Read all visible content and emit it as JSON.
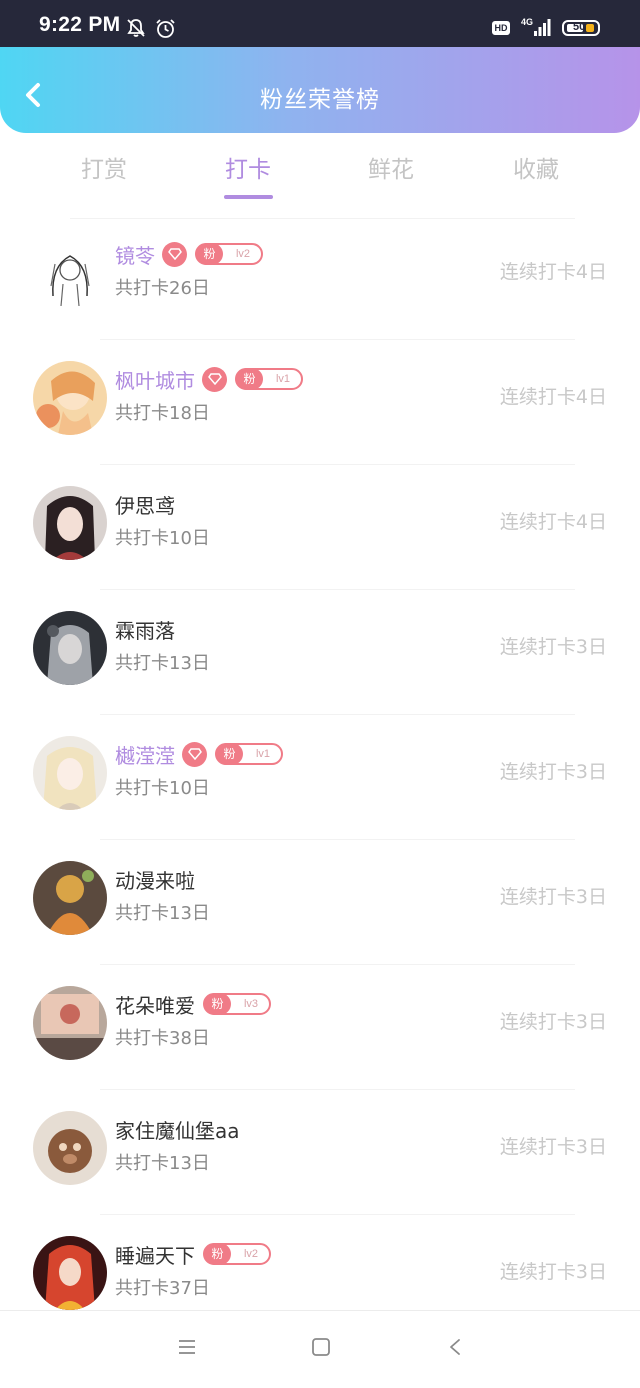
{
  "status_bar": {
    "time": "9:22 PM",
    "network": "4G",
    "hd_label": "HD",
    "battery": "50",
    "icons": [
      "bell-off-icon",
      "alarm-icon",
      "hd-icon",
      "signal-icon",
      "battery-icon"
    ]
  },
  "header": {
    "title": "粉丝荣誉榜",
    "back_icon": "chevron-left-icon"
  },
  "tabs": [
    {
      "label": "打赏",
      "active": false
    },
    {
      "label": "打卡",
      "active": true
    },
    {
      "label": "鲜花",
      "active": false
    },
    {
      "label": "收藏",
      "active": false
    }
  ],
  "colors": {
    "accent": "#b08ce0",
    "badge": "#f07b87",
    "header_gradient": [
      "#4fd6f3",
      "#b693e9"
    ],
    "status_bar": "#26283a"
  },
  "fans": [
    {
      "name": "镜苓",
      "vip": true,
      "fan_level": "lv2",
      "total": "共打卡26日",
      "streak": "连续打卡4日"
    },
    {
      "name": "枫叶城市",
      "vip": true,
      "fan_level": "lv1",
      "total": "共打卡18日",
      "streak": "连续打卡4日"
    },
    {
      "name": "伊思鸢",
      "vip": false,
      "fan_level": null,
      "total": "共打卡10日",
      "streak": "连续打卡4日"
    },
    {
      "name": "霖雨落",
      "vip": false,
      "fan_level": null,
      "total": "共打卡13日",
      "streak": "连续打卡3日"
    },
    {
      "name": "樾滢滢",
      "vip": true,
      "fan_level": "lv1",
      "total": "共打卡10日",
      "streak": "连续打卡3日"
    },
    {
      "name": "动漫来啦",
      "vip": false,
      "fan_level": null,
      "total": "共打卡13日",
      "streak": "连续打卡3日"
    },
    {
      "name": "花朵唯爱",
      "vip": false,
      "fan_level": "lv3",
      "total": "共打卡38日",
      "streak": "连续打卡3日"
    },
    {
      "name": "家住魔仙堡aa",
      "vip": false,
      "fan_level": null,
      "total": "共打卡13日",
      "streak": "连续打卡3日"
    },
    {
      "name": "睡遍天下",
      "vip": false,
      "fan_level": "lv2",
      "total": "共打卡37日",
      "streak": "连续打卡3日"
    }
  ],
  "fan_badge_label": "粉",
  "nav_bar": {
    "icons": [
      "menu-icon",
      "home-square-icon",
      "back-triangle-icon"
    ]
  }
}
